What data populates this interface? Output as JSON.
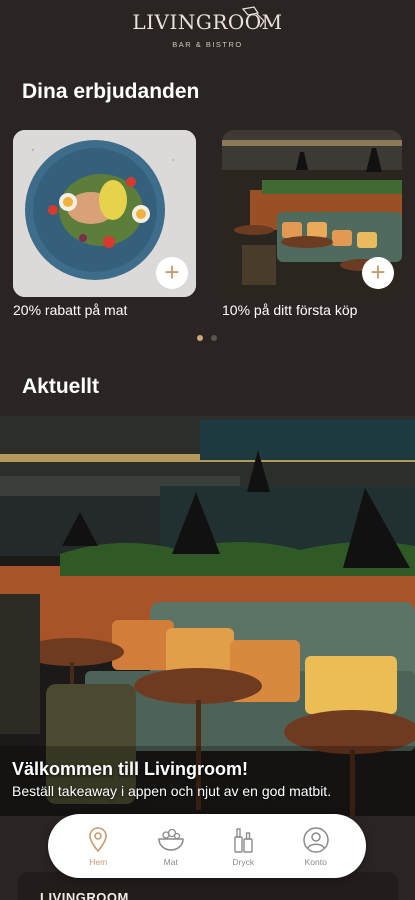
{
  "header": {
    "logo_text": "LIVINGROOM",
    "logo_subtitle": "BAR & BISTRO"
  },
  "offers": {
    "title": "Dina erbjudanden",
    "items": [
      {
        "label": "20% rabatt på mat"
      },
      {
        "label": "10% på ditt första köp"
      }
    ],
    "pager_active_index": 0,
    "pager_count": 2
  },
  "news": {
    "title": "Aktuellt",
    "hero_title": "Välkommen till Livingroom!",
    "hero_subtitle": "Beställ takeaway i appen och njut av en god matbit."
  },
  "bottom_panel": {
    "text": "LIVINGROOM"
  },
  "tabbar": {
    "items": [
      {
        "label": "Hem",
        "icon": "location-pin-icon",
        "active": true
      },
      {
        "label": "Mat",
        "icon": "food-bowl-icon",
        "active": false
      },
      {
        "label": "Dryck",
        "icon": "bottles-icon",
        "active": false
      },
      {
        "label": "Konto",
        "icon": "user-icon",
        "active": false
      }
    ]
  },
  "colors": {
    "background": "#2a2422",
    "accent": "#c89a70",
    "tab_inactive": "#8b8b8b"
  }
}
